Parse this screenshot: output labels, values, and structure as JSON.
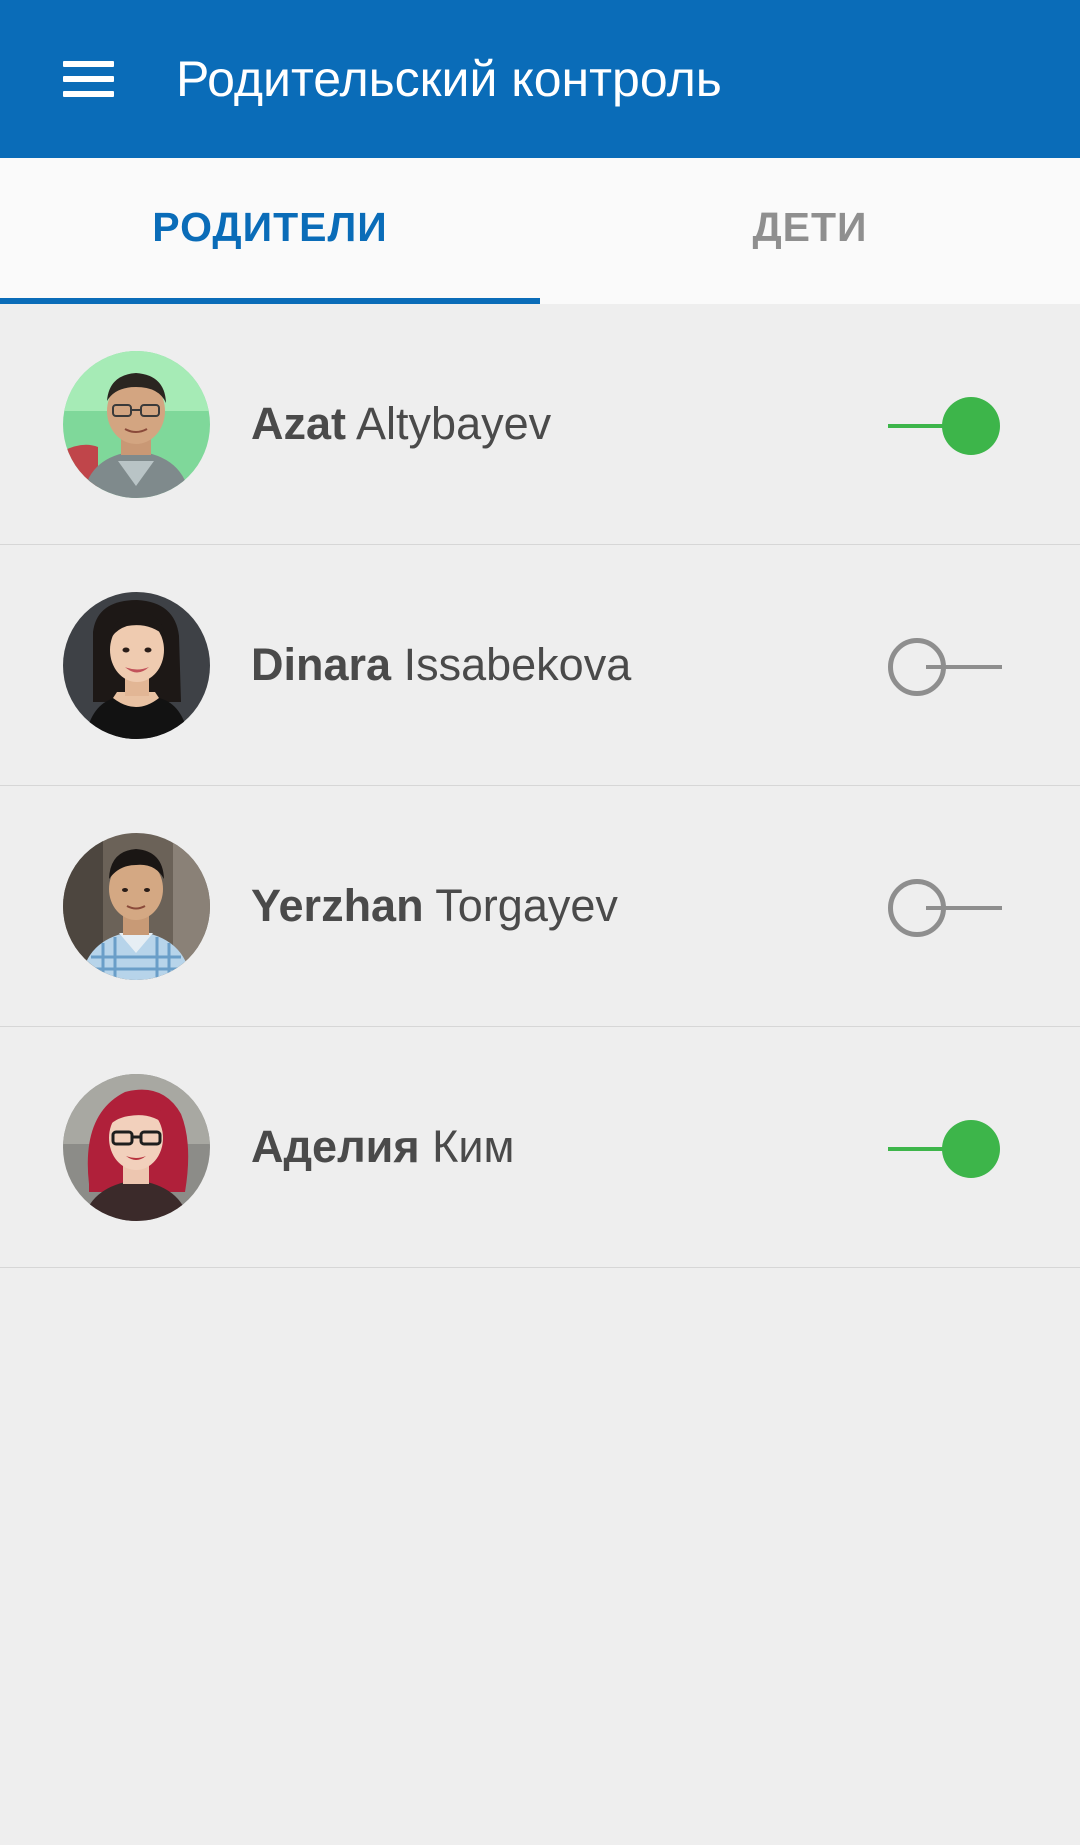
{
  "appbar": {
    "title": "Родительский контроль",
    "menu_icon": "hamburger-menu-icon",
    "color": "#0a6cb8"
  },
  "tabs": [
    {
      "label": "РОДИТЕЛИ",
      "active": true
    },
    {
      "label": "ДЕТИ",
      "active": false
    }
  ],
  "parents": [
    {
      "first": "Azat",
      "last": "Altybayev",
      "enabled": true,
      "avatar": "avatar-photo-man-glasses-green-background"
    },
    {
      "first": "Dinara",
      "last": "Issabekova",
      "enabled": false,
      "avatar": "avatar-photo-woman-dark-hair"
    },
    {
      "first": "Yerzhan",
      "last": "Torgayev",
      "enabled": false,
      "avatar": "avatar-photo-man-plaid-shirt"
    },
    {
      "first": "Аделия",
      "last": "Ким",
      "enabled": true,
      "avatar": "avatar-photo-woman-red-hair-glasses"
    }
  ],
  "colors": {
    "accent": "#0a6cb8",
    "toggle_on": "#3db54a",
    "toggle_off": "#8e8e8e",
    "background": "#eeeeee"
  }
}
